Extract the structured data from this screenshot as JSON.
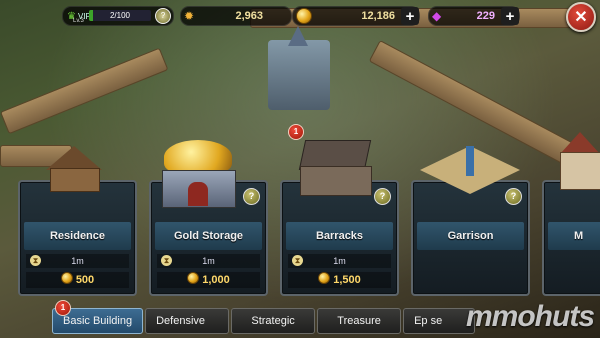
{
  "hud": {
    "vip_label": "VIP",
    "vip_level": "Lv.3",
    "vip_progress_text": "2/100",
    "vip_progress_fraction": 0.02,
    "food": "2,963",
    "gold": "12,186",
    "gems": "229"
  },
  "map": {
    "notification_badge": "1"
  },
  "buildings": [
    {
      "name": "Residence",
      "time": "1m",
      "cost": "500"
    },
    {
      "name": "Gold Storage",
      "time": "1m",
      "cost": "1,000"
    },
    {
      "name": "Barracks",
      "time": "1m",
      "cost": "1,500"
    },
    {
      "name": "Garrison",
      "time": "",
      "cost": ""
    },
    {
      "name": "M",
      "time": "",
      "cost": ""
    }
  ],
  "tabs": [
    {
      "label": "Basic Building",
      "active": true,
      "badge": "1"
    },
    {
      "label": "Defensive",
      "active": false
    },
    {
      "label": "Strategic",
      "active": false
    },
    {
      "label": "Treasure",
      "active": false
    },
    {
      "label": "Ep se",
      "active": false
    }
  ],
  "watermark": "mmohuts",
  "colors": {
    "accent_tab": "#2f5c80",
    "gold_text": "#ffd86a",
    "close_red": "#c0281a"
  }
}
